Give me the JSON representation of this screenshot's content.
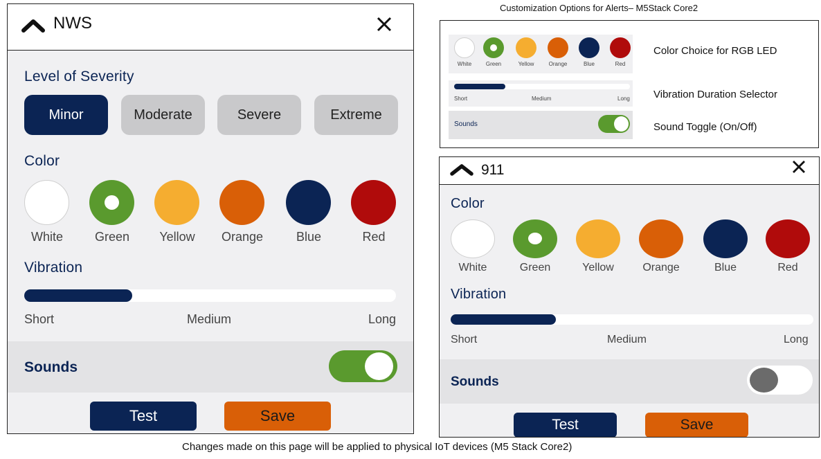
{
  "figure_title": "Customization Options for Alerts– M5Stack Core2",
  "footer": "Changes made on this page will be applied to physical IoT devices (M5 Stack Core2)",
  "colors": {
    "navy": "#0b2454",
    "green": "#5a9a2e",
    "yellow": "#f5ad30",
    "orange": "#d95f07",
    "blue": "#0b2454",
    "red": "#b00b0b",
    "white": "#ffffff",
    "panel_bg": "#f0f0f2",
    "inactive_button": "#c9c9cb",
    "toggle_on": "#5a9a2e",
    "toggle_off_knob": "#6b6b6b"
  },
  "nws_panel": {
    "title": "NWS",
    "collapse_icon": "chevron-up-icon",
    "close_icon": "close-icon",
    "severity": {
      "label": "Level of Severity",
      "options": [
        "Minor",
        "Moderate",
        "Severe",
        "Extreme"
      ],
      "selected": "Minor"
    },
    "color": {
      "label": "Color",
      "options": [
        "White",
        "Green",
        "Yellow",
        "Orange",
        "Blue",
        "Red"
      ],
      "selected": "Green"
    },
    "vibration": {
      "label": "Vibration",
      "ticks": [
        "Short",
        "Medium",
        "Long"
      ],
      "level": 0.29
    },
    "sounds": {
      "label": "Sounds",
      "on": true
    },
    "buttons": {
      "test": "Test",
      "save": "Save"
    }
  },
  "legend": {
    "colors_row_labels": [
      "White",
      "Green",
      "Yellow",
      "Orange",
      "Blue",
      "Red"
    ],
    "vibration_ticks": [
      "Short",
      "Medium",
      "Long"
    ],
    "vibration_level": 0.29,
    "sounds_label": "Sounds",
    "sounds_on": true,
    "descriptions": {
      "color": "Color Choice for RGB LED",
      "vibration": "Vibration Duration Selector",
      "sound": "Sound Toggle (On/Off)"
    }
  },
  "p911_panel": {
    "title": "911",
    "collapse_icon": "chevron-up-icon",
    "close_icon": "close-icon",
    "color": {
      "label": "Color",
      "options": [
        "White",
        "Green",
        "Yellow",
        "Orange",
        "Blue",
        "Red"
      ],
      "selected": "Green"
    },
    "vibration": {
      "label": "Vibration",
      "ticks": [
        "Short",
        "Medium",
        "Long"
      ],
      "level": 0.29
    },
    "sounds": {
      "label": "Sounds",
      "on": false
    },
    "buttons": {
      "test": "Test",
      "save": "Save"
    }
  }
}
